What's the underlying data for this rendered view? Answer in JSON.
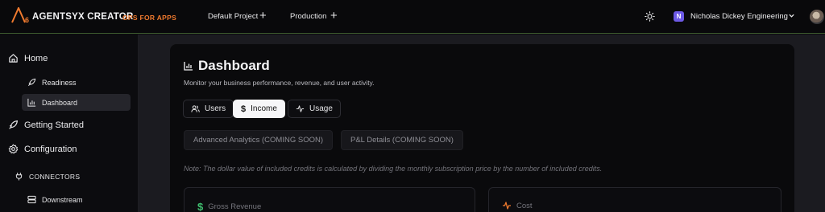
{
  "header": {
    "logo_letter": "A",
    "logo_sub": "6",
    "brand": "AGENTSYX CREATOR",
    "brand_tag": "OPS FOR APPS",
    "project": "Default Project",
    "environment": "Production",
    "org_badge": "N",
    "org_name": "Nicholas Dickey Engineering",
    "accent": "#f07a2e",
    "org_color": "#6d5ae6"
  },
  "sidebar": {
    "home": "Home",
    "readiness": "Readiness",
    "dashboard": "Dashboard",
    "getting_started": "Getting Started",
    "configuration": "Configuration",
    "connectors": "CONNECTORS",
    "downstream": "Downstream"
  },
  "main": {
    "title": "Dashboard",
    "subtitle": "Monitor your business performance, revenue, and user activity.",
    "tabs": [
      {
        "label": "Users",
        "icon": "users-icon"
      },
      {
        "label": "Income",
        "icon": "dollar-icon",
        "active": true
      },
      {
        "label": "Usage",
        "icon": "activity-icon"
      }
    ],
    "advanced_analytics": "Advanced Analytics (COMING SOON)",
    "pl_details": "P&L Details (COMING SOON)",
    "note": "Note: The dollar value of included credits is calculated by dividing the monthly subscription price by the number of included credits.",
    "stats": [
      {
        "label": "Gross Revenue",
        "icon": "dollar-icon",
        "color": "#3fbf6f"
      },
      {
        "label": "Cost",
        "icon": "activity-icon",
        "color": "#f07a2e"
      }
    ]
  }
}
